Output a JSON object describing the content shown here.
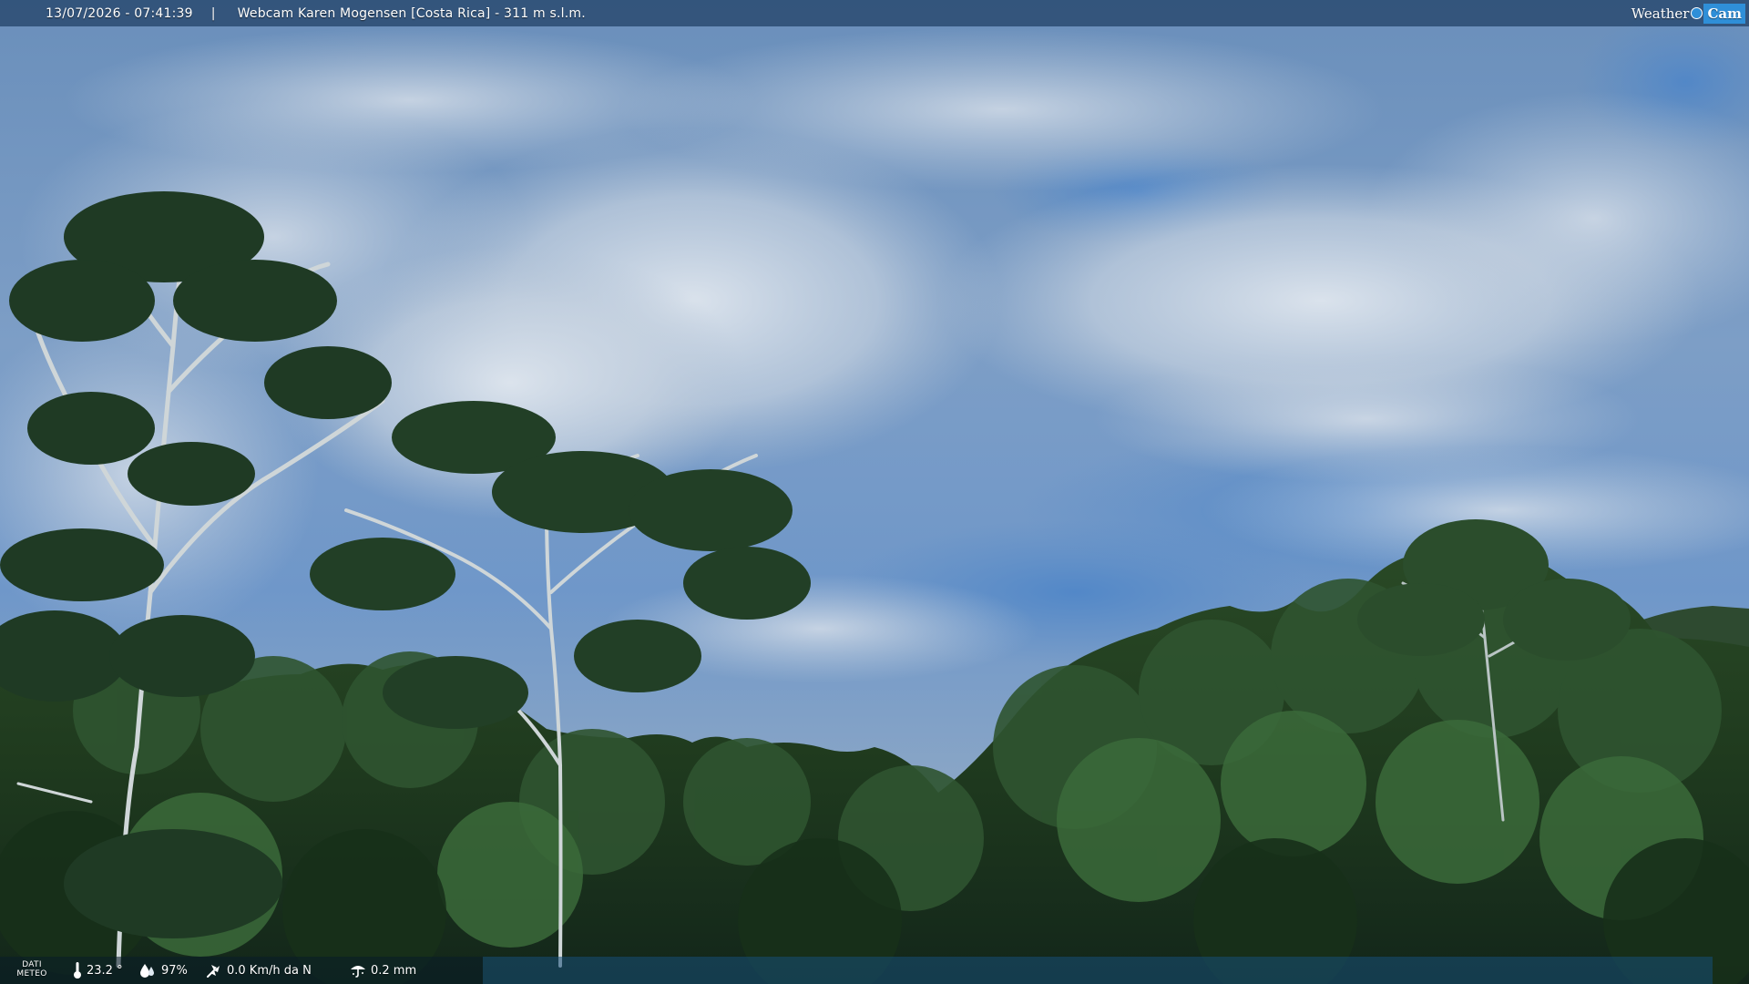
{
  "top_bar": {
    "datetime": "13/07/2026 - 07:41:39",
    "separator": "|",
    "title": "Webcam Karen Mogensen [Costa Rica] - 311 m s.l.m."
  },
  "logo": {
    "part1": "Weather",
    "part2": "Cam"
  },
  "meteo": {
    "label_line1": "DATI",
    "label_line2": "METEO",
    "temperature": "23.2 °",
    "humidity": "97%",
    "wind": "0.0 Km/h da N",
    "rain": "0.2 mm"
  },
  "icons": {
    "temperature": "thermometer-icon",
    "humidity": "humidity-icon",
    "wind": "wind-icon",
    "rain": "rain-icon"
  },
  "colors": {
    "top_bar": "#1e3e64",
    "logo_accent": "#2f8fd8",
    "sky_top": "#5f88b6",
    "foliage": "#1f3a20"
  }
}
